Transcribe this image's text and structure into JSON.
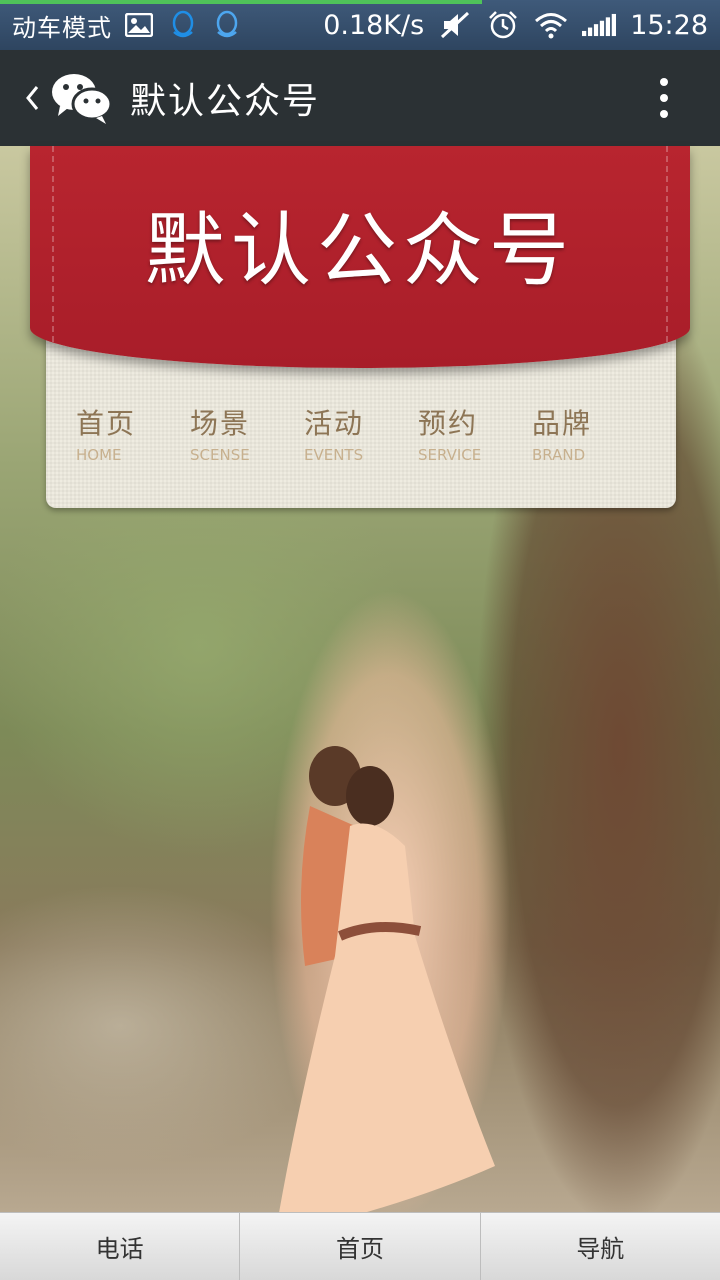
{
  "status_bar": {
    "mode_label": "动车模式",
    "network_speed": "0.18K/s",
    "time": "15:28",
    "progress_fraction": 0.67,
    "icons": [
      "image-icon",
      "qq-icon",
      "qq-icon",
      "mute-icon",
      "alarm-icon",
      "wifi-icon",
      "signal-icon"
    ]
  },
  "title_bar": {
    "title": "默认公众号",
    "icons": [
      "back-icon",
      "wechat-icon",
      "more-icon"
    ]
  },
  "banner": {
    "title": "默认公众号",
    "ribbon_color": "#b8252f"
  },
  "menu": {
    "items": [
      {
        "cn": "首页",
        "en": "HOME"
      },
      {
        "cn": "场景",
        "en": "SCENSE"
      },
      {
        "cn": "活动",
        "en": "EVENTS"
      },
      {
        "cn": "预约",
        "en": "SERVICE"
      },
      {
        "cn": "品牌",
        "en": "BRAND"
      }
    ]
  },
  "bottom_bar": {
    "buttons": [
      "电话",
      "首页",
      "导航"
    ]
  }
}
